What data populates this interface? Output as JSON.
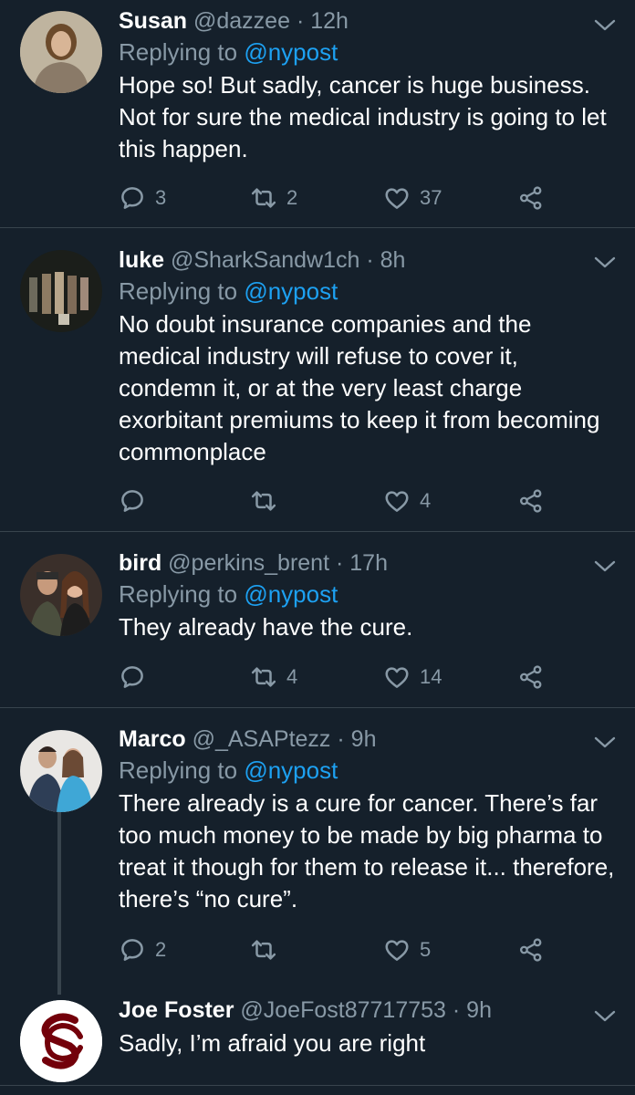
{
  "tweets": [
    {
      "name": "Susan",
      "handle": "@dazzee",
      "separator": "·",
      "time": "12h",
      "replying_prefix": "Replying to ",
      "replying_to": "@nypost",
      "text": "Hope so! But sadly, cancer is huge business. Not for sure the medical industry is going to let this happen.",
      "replies": "3",
      "retweets": "2",
      "likes": "37"
    },
    {
      "name": "luke",
      "handle": "@SharkSandw1ch",
      "separator": "·",
      "time": "8h",
      "replying_prefix": "Replying to ",
      "replying_to": "@nypost",
      "text": "No doubt insurance companies and the medical industry will refuse to cover it, condemn it, or at the very least charge exorbitant premiums to keep it from becoming commonplace",
      "replies": "",
      "retweets": "",
      "likes": "4"
    },
    {
      "name": "bird",
      "handle": "@perkins_brent",
      "separator": "·",
      "time": "17h",
      "replying_prefix": "Replying to ",
      "replying_to": "@nypost",
      "text": "They already have the cure.",
      "replies": "",
      "retweets": "4",
      "likes": "14"
    },
    {
      "name": "Marco",
      "handle": "@_ASAPtezz",
      "separator": "·",
      "time": "9h",
      "replying_prefix": "Replying to ",
      "replying_to": "@nypost",
      "text": "There already is a cure for cancer. There’s far too much money to be made by big pharma to treat it though for them to release it... therefore, there’s “no cure”.",
      "replies": "2",
      "retweets": "",
      "likes": "5"
    },
    {
      "name": "Joe Foster",
      "handle": "@JoeFost87717753",
      "separator": "·",
      "time": "9h",
      "text": "Sadly, I’m afraid you are right"
    }
  ],
  "colors": {
    "background": "#15202b",
    "secondary_text": "#8899a6",
    "link": "#1da1f2",
    "divider": "#38444d",
    "logo_red": "#73000a"
  },
  "icons": [
    "reply-icon",
    "retweet-icon",
    "like-icon",
    "share-icon",
    "chevron-down-icon"
  ]
}
